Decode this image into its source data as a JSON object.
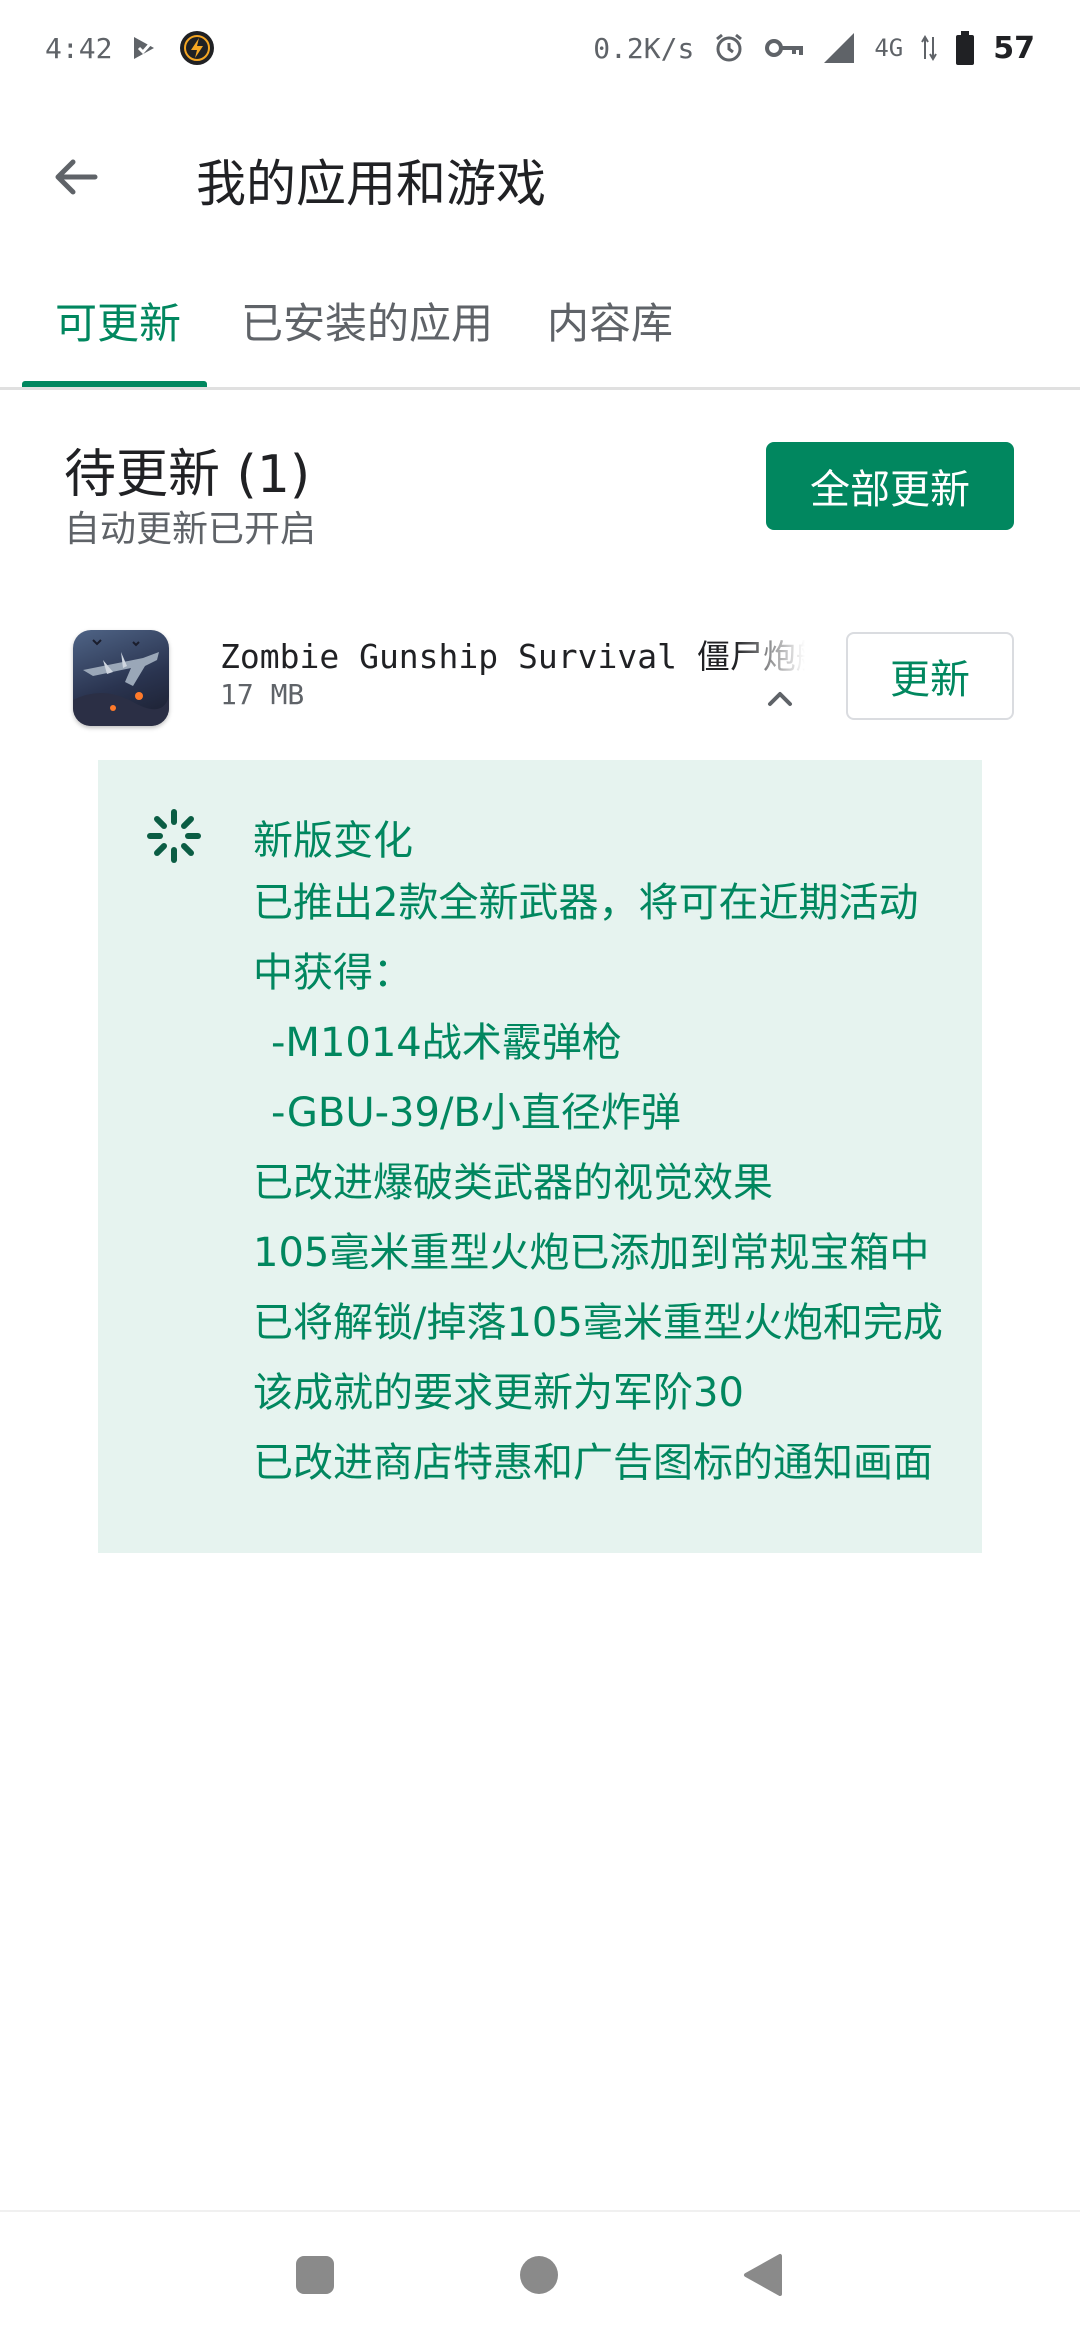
{
  "status_bar": {
    "time": "4:42",
    "left_icons": [
      "play-protect-icon",
      "bolt-circle-icon"
    ],
    "net_speed": "0.2K/s",
    "network": "4G",
    "battery": "57",
    "right_icons": [
      "alarm-icon",
      "vpn-key-icon",
      "signal-icon",
      "data-arrows-icon",
      "battery-icon"
    ]
  },
  "app_bar": {
    "title": "我的应用和游戏"
  },
  "tabs": [
    {
      "label": "可更新",
      "active": true
    },
    {
      "label": "已安装的应用",
      "active": false
    },
    {
      "label": "内容库",
      "active": false
    }
  ],
  "pending": {
    "title": "待更新 (1)",
    "subtitle": "自动更新已开启",
    "update_all_label": "全部更新"
  },
  "app": {
    "name": "Zombie Gunship Survival 僵尸炮艇",
    "size": "17 MB",
    "update_label": "更新"
  },
  "whats_new": {
    "title": "新版变化",
    "lines": [
      "已推出2款全新武器，将可在近期活动",
      "中获得：",
      " -M1014战术霰弹枪",
      " -GBU-39/B小直径炸弹",
      "已改进爆破类武器的视觉效果",
      "105毫米重型火炮已添加到常规宝箱中",
      "已将解锁/掉落105毫米重型火炮和完成",
      "该成就的要求更新为军阶30",
      "已改进商店特惠和广告图标的通知画面"
    ]
  },
  "colors": {
    "accent": "#01875f",
    "panel_bg": "#e6f3ef",
    "text_primary": "#202124",
    "text_secondary": "#5f6368"
  }
}
